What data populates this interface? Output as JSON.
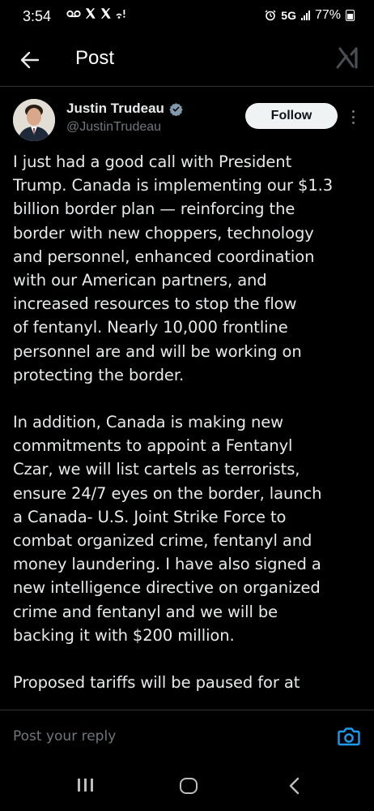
{
  "status_bar": {
    "time": "3:54",
    "left_icons": [
      "voicemail-icon",
      "x-logo-icon",
      "x-logo-icon",
      "wifi-calling-icon"
    ],
    "right_icons": [
      "alarm-icon",
      "signal-icon",
      "battery-icon"
    ],
    "network": "5G",
    "battery": "77%"
  },
  "header": {
    "title": "Post",
    "back_icon": "arrow-left-icon",
    "grok_icon": "grok-icon"
  },
  "post": {
    "author": {
      "name": "Justin Trudeau",
      "handle": "@JustinTrudeau",
      "verified": true,
      "badge_color": "#829aab"
    },
    "follow_label": "Follow",
    "lines": [
      "I just had a good call with President",
      "Trump. Canada is implementing our $1.3",
      "billion border plan — reinforcing the",
      "border with new choppers, technology",
      "and personnel, enhanced coordination",
      "with our American partners, and",
      "increased resources to stop the flow",
      "of fentanyl. Nearly 10,000 frontline",
      "personnel are and will be working on",
      "protecting the border.",
      "",
      "In addition, Canada is making new",
      "commitments to appoint a Fentanyl",
      "Czar, we will list cartels as terrorists,",
      "ensure 24/7 eyes on the border, launch",
      "a Canada- U.S. Joint Strike Force to",
      "combat organized crime, fentanyl and",
      "money laundering. I have also signed a",
      "new intelligence directive on organized",
      "crime and fentanyl and we will be",
      "backing it with $200 million.",
      "",
      "Proposed tariffs will be paused for at"
    ]
  },
  "reply": {
    "placeholder": "Post your reply",
    "camera_icon": "camera-icon"
  },
  "nav": {
    "recents_icon": "recents-icon",
    "home_icon": "home-icon",
    "back_icon": "chevron-left-icon"
  },
  "colors": {
    "background": "#000000",
    "text": "#e7e9ea",
    "secondary_text": "#71767b",
    "divider": "#2f3336",
    "accent": "#1d9bf0"
  }
}
